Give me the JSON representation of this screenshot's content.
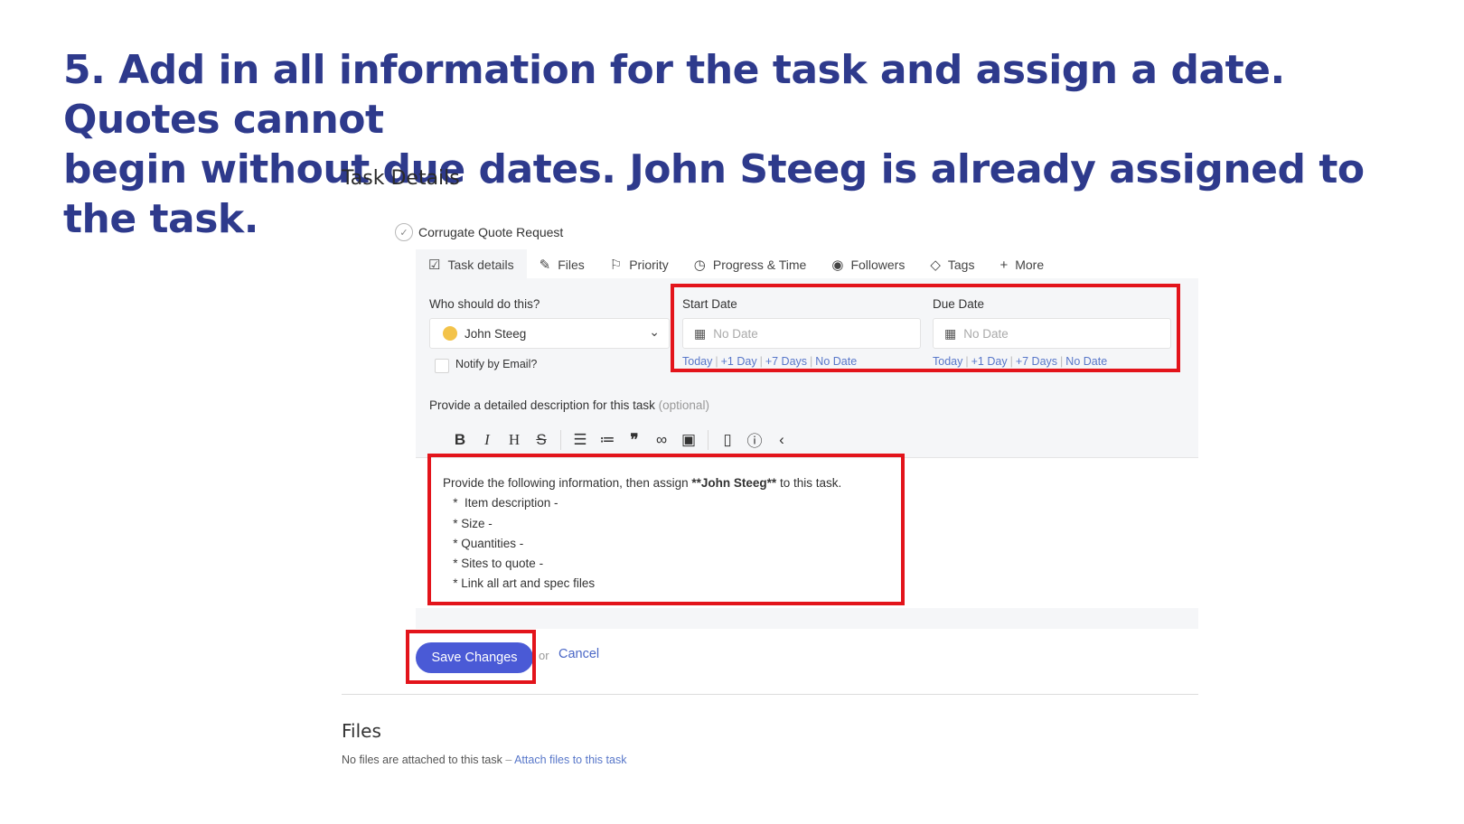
{
  "headline": {
    "line1": "5. Add in all information for the task and assign a date. Quotes cannot",
    "line2": "begin without due dates. John Steeg is already assigned to the task."
  },
  "section_title": "Task Details",
  "task": {
    "name": "Corrugate Quote Request"
  },
  "tabs": [
    {
      "label": "Task details",
      "icon": "checkbox-icon"
    },
    {
      "label": "Files",
      "icon": "paperclip-icon"
    },
    {
      "label": "Priority",
      "icon": "flag-icon"
    },
    {
      "label": "Progress & Time",
      "icon": "clock-icon"
    },
    {
      "label": "Followers",
      "icon": "eye-icon"
    },
    {
      "label": "Tags",
      "icon": "tag-icon"
    },
    {
      "label": "More",
      "icon": "plus-icon"
    }
  ],
  "assignee": {
    "label": "Who should do this?",
    "value": "John Steeg",
    "notify_label": "Notify by Email?"
  },
  "start_date": {
    "label": "Start Date",
    "placeholder": "No Date",
    "quick": [
      "Today",
      "+1 Day",
      "+7 Days",
      "No Date"
    ]
  },
  "due_date": {
    "label": "Due Date",
    "placeholder": "No Date",
    "quick": [
      "Today",
      "+1 Day",
      "+7 Days",
      "No Date"
    ]
  },
  "description": {
    "label": "Provide a detailed description for this task",
    "optional": "(optional)",
    "line1_pre": "Provide the following information, then assign ",
    "line1_bold": "**John Steeg**",
    "line1_post": " to this task.",
    "items": [
      "   *  Item description -",
      "   * Size -",
      "   * Quantities -",
      "   * Sites to quote -",
      "   * Link all art and spec files"
    ]
  },
  "actions": {
    "save": "Save Changes",
    "or": "or",
    "cancel": "Cancel"
  },
  "files": {
    "title": "Files",
    "empty": "No files are attached to this task",
    "dash": " – ",
    "attach": "Attach files to this task"
  },
  "colors": {
    "headline": "#2e3a8c",
    "highlight": "#e3141b",
    "primary": "#4a5ad6",
    "link": "#5877c9"
  }
}
